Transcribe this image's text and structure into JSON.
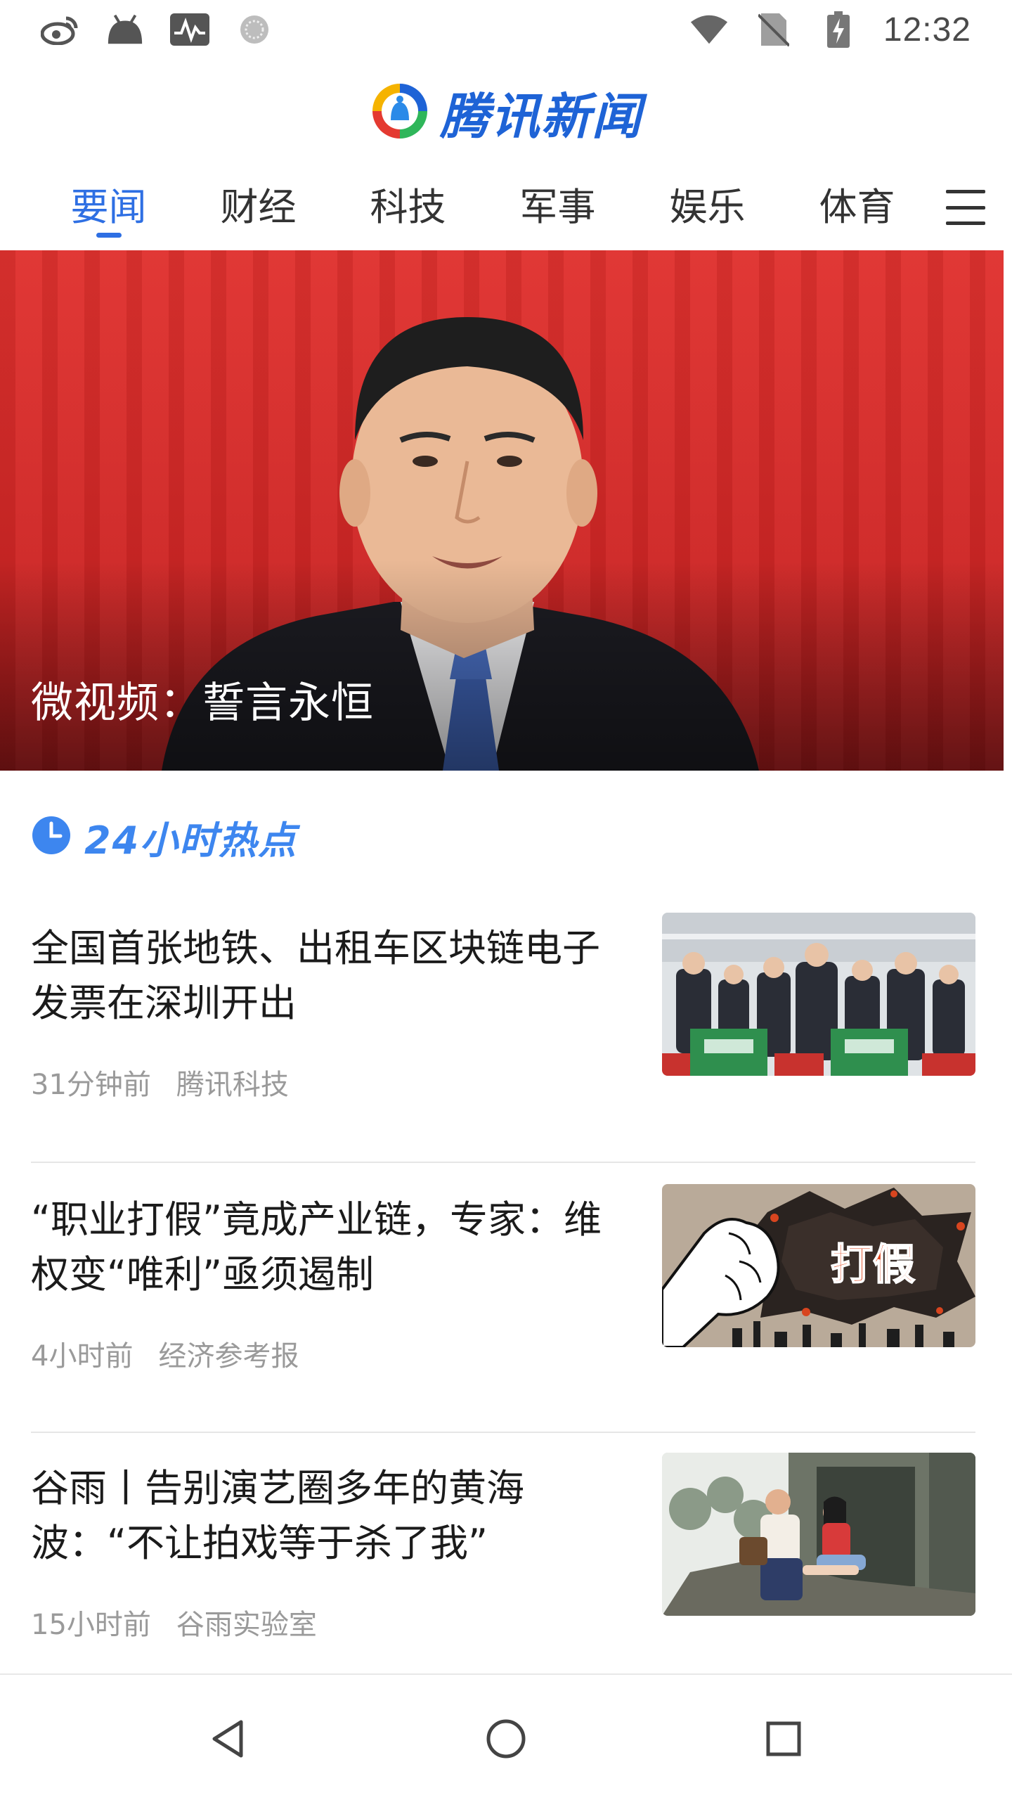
{
  "status_bar": {
    "time": "12:32",
    "left_icons": [
      "weibo-icon",
      "android-icon",
      "activity-monitor-icon",
      "loading-icon"
    ],
    "right_icons": [
      "wifi-icon",
      "no-sim-icon",
      "battery-charging-icon"
    ]
  },
  "header": {
    "logo_text": "腾讯新闻"
  },
  "tabs": [
    {
      "label": "要闻",
      "active": true
    },
    {
      "label": "财经",
      "active": false
    },
    {
      "label": "科技",
      "active": false
    },
    {
      "label": "军事",
      "active": false
    },
    {
      "label": "娱乐",
      "active": false
    },
    {
      "label": "体育",
      "active": false
    }
  ],
  "hero": {
    "caption": "微视频：誓言永恒"
  },
  "section": {
    "title": "24小时热点"
  },
  "news": [
    {
      "title": "全国首张地铁、出租车区块链电子发票在深圳开出",
      "time": "31分钟前",
      "source": "腾讯科技"
    },
    {
      "title": "“职业打假”竟成产业链，专家：维权变“唯利”亟须遏制",
      "time": "4小时前",
      "source": "经济参考报",
      "thumb_text": "打假"
    },
    {
      "title": "谷雨丨告别演艺圈多年的黄海波：“不让拍戏等于杀了我”",
      "time": "15小时前",
      "source": "谷雨实验室"
    }
  ],
  "colors": {
    "accent": "#2e6fe3",
    "section_title": "#3d86ef",
    "hero_red": "#d42a28",
    "meta_gray": "#9a9a9a"
  }
}
